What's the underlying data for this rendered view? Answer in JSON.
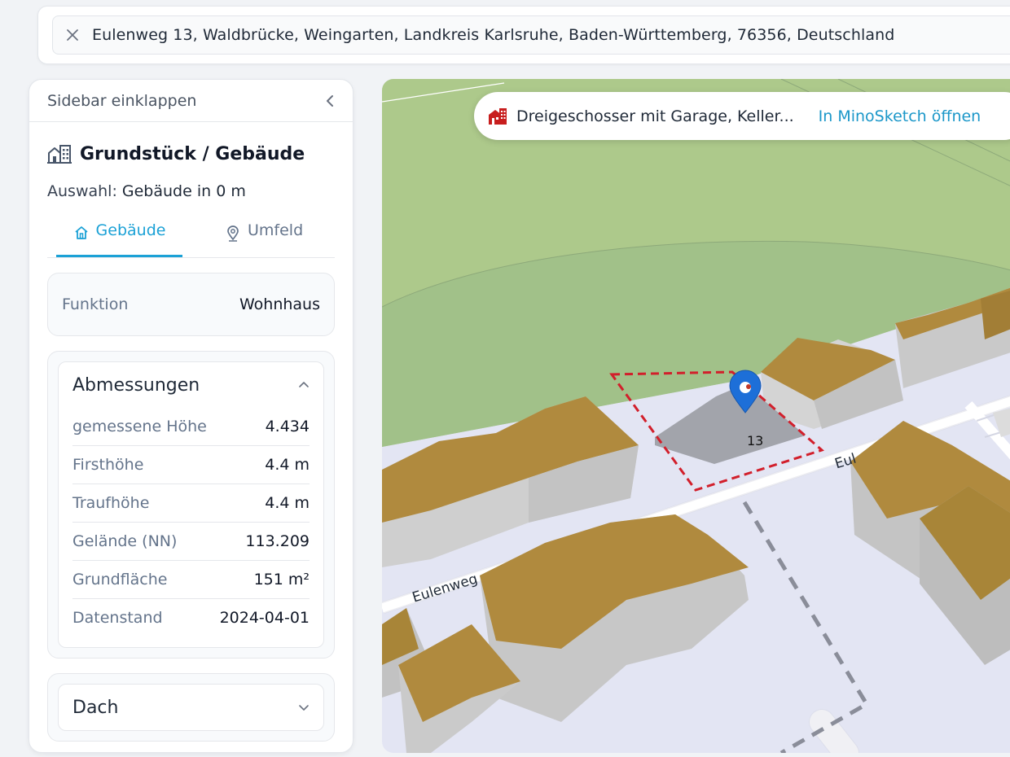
{
  "search": {
    "value": "Eulenweg 13, Waldbrücke, Weingarten, Landkreis Karlsruhe, Baden-Württemberg, 76356, Deutschland",
    "clear_icon": "close-icon"
  },
  "sidebar": {
    "collapse_label": "Sidebar einklappen",
    "section_title": "Grundstück / Gebäude",
    "auswahl_label": "Auswahl:",
    "auswahl_value": "Gebäude in 0 m",
    "tabs": [
      {
        "label": "Gebäude",
        "icon": "home-icon",
        "active": true
      },
      {
        "label": "Umfeld",
        "icon": "map-pin-icon",
        "active": false
      }
    ],
    "funktion": {
      "label": "Funktion",
      "value": "Wohnhaus"
    },
    "abmessungen": {
      "title": "Abmessungen",
      "rows": [
        {
          "label": "gemessene Höhe",
          "value": "4.434"
        },
        {
          "label": "Firsthöhe",
          "value": "4.4 m"
        },
        {
          "label": "Traufhöhe",
          "value": "4.4 m"
        },
        {
          "label": "Gelände (NN)",
          "value": "113.209"
        },
        {
          "label": "Grundfläche",
          "value": "151 m²"
        },
        {
          "label": "Datenstand",
          "value": "2024-04-01"
        }
      ]
    },
    "dach": {
      "title": "Dach"
    }
  },
  "map": {
    "popup_text": "Dreigeschosser mit Garage, Keller...",
    "popup_link": "In MinoSketch öffnen",
    "house_number": "13",
    "street_labels": [
      "Eulenweg",
      "Eul"
    ]
  },
  "colors": {
    "accent": "#1ba1d6",
    "roof": "#b08a3e",
    "wall": "#c9c9c9",
    "grass": "#adc98b",
    "parcel_border": "#d21f2b",
    "marker": "#1d6fd8"
  }
}
